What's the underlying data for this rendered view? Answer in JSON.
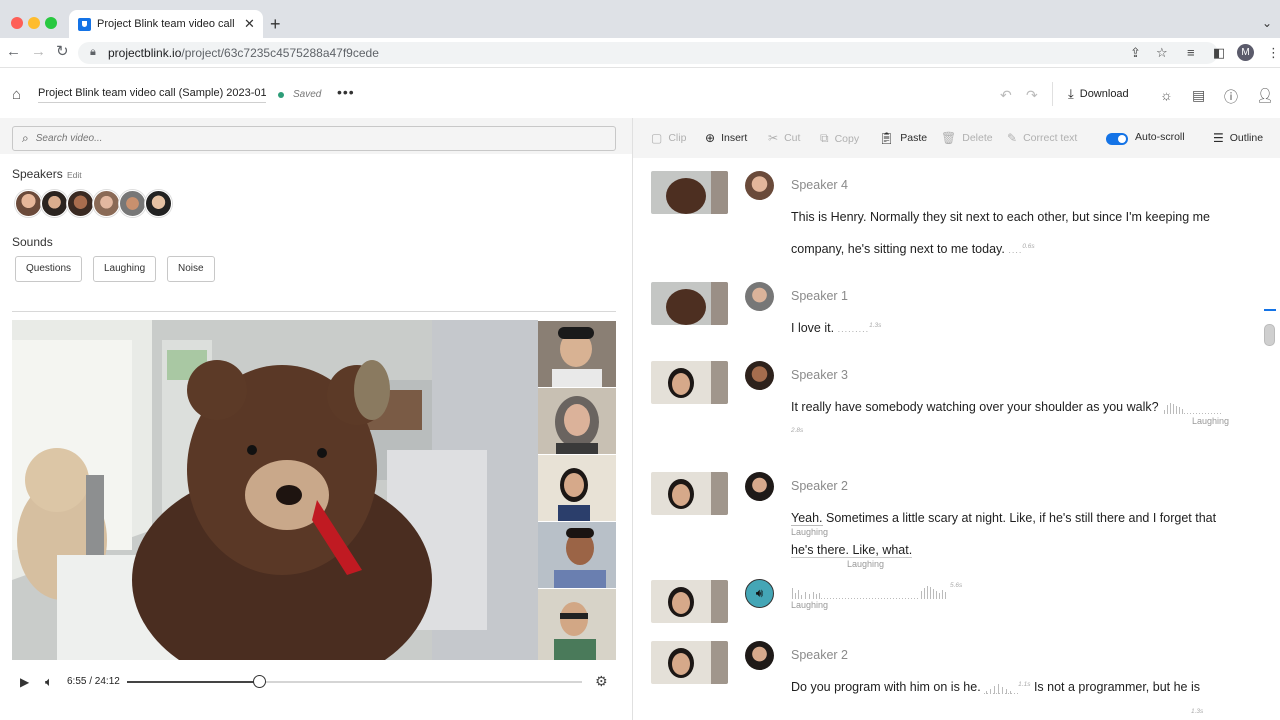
{
  "browser": {
    "tab_title": "Project Blink team video call (S",
    "url_host": "projectblink.io",
    "url_path": "/project/63c7235c4575288a47f9cede",
    "profile_initial": "M"
  },
  "header": {
    "project_title": "Project Blink team video call (Sample) 2023-01-...",
    "status": "Saved",
    "download_label": "Download"
  },
  "left": {
    "search_placeholder": "Search video...",
    "speakers_label": "Speakers",
    "speakers_edit": "Edit",
    "sounds_label": "Sounds",
    "sound_chips": [
      "Questions",
      "Laughing",
      "Noise"
    ],
    "player": {
      "time": "6:55 / 24:12",
      "progress_fraction": 0.29
    }
  },
  "toolbar": {
    "clip": "Clip",
    "insert": "Insert",
    "cut": "Cut",
    "copy": "Copy",
    "paste": "Paste",
    "delete": "Delete",
    "correct_text": "Correct text",
    "autoscroll": "Auto-scroll",
    "outline": "Outline"
  },
  "transcript": [
    {
      "speaker": "Speaker 4",
      "line1": "This is Henry. Normally they sit next to each other, but since I'm keeping me",
      "line2": "company, he's sitting next to me today.",
      "pause": "0.6s"
    },
    {
      "speaker": "Speaker 1",
      "line1": "I love it.",
      "pause": "1.3s"
    },
    {
      "speaker": "Speaker 3",
      "line1": "It really have somebody watching over your shoulder as you walk?",
      "sound": "Laughing",
      "pause": "2.8s"
    },
    {
      "speaker": "Speaker 2",
      "line1_a": "Yeah.",
      "line1_b": "Sometimes a little scary at night. Like, if he's still there and I forget that",
      "line2": "he's there. Like, what.",
      "sound1": "Laughing",
      "sound2": "Laughing"
    },
    {
      "sound_only": "Laughing",
      "pause": "5.6s"
    },
    {
      "speaker": "Speaker 2",
      "line1_a": "Do you program with him on is he.",
      "line1_b": "Is not a programmer, but he is",
      "pause": "1.1s",
      "pause2": "1.3s"
    }
  ]
}
